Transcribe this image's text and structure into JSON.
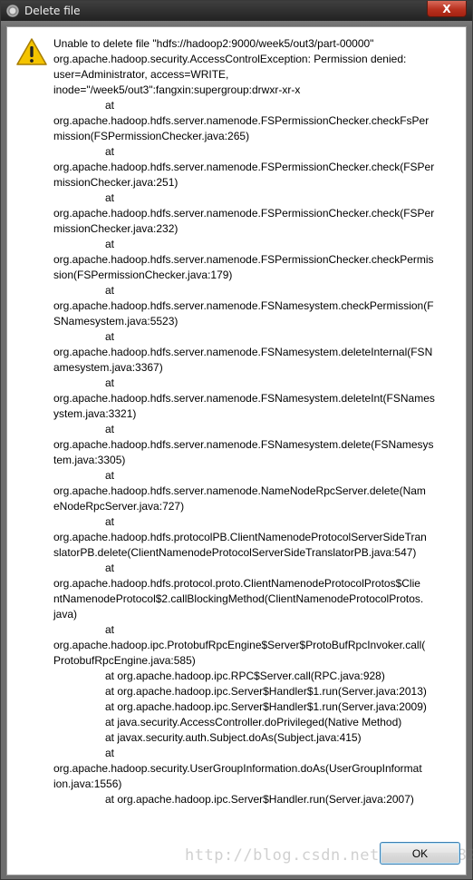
{
  "window": {
    "title": "Delete file",
    "close_label": "X"
  },
  "dialog": {
    "icon": "warning-icon",
    "message_lines": [
      {
        "text": "Unable to delete file \"hdfs://hadoop2:9000/week5/out3/part-00000\"",
        "indent": false
      },
      {
        "text": "org.apache.hadoop.security.AccessControlException: Permission denied:",
        "indent": false
      },
      {
        "text": "user=Administrator, access=WRITE,",
        "indent": false
      },
      {
        "text": "inode=\"/week5/out3\":fangxin:supergroup:drwxr-xr-x",
        "indent": false
      },
      {
        "text": "at",
        "indent": true
      },
      {
        "text": "org.apache.hadoop.hdfs.server.namenode.FSPermissionChecker.checkFsPer",
        "indent": false
      },
      {
        "text": "mission(FSPermissionChecker.java:265)",
        "indent": false
      },
      {
        "text": "at",
        "indent": true
      },
      {
        "text": "org.apache.hadoop.hdfs.server.namenode.FSPermissionChecker.check(FSPer",
        "indent": false
      },
      {
        "text": "missionChecker.java:251)",
        "indent": false
      },
      {
        "text": "at",
        "indent": true
      },
      {
        "text": "org.apache.hadoop.hdfs.server.namenode.FSPermissionChecker.check(FSPer",
        "indent": false
      },
      {
        "text": "missionChecker.java:232)",
        "indent": false
      },
      {
        "text": "at",
        "indent": true
      },
      {
        "text": "org.apache.hadoop.hdfs.server.namenode.FSPermissionChecker.checkPermis",
        "indent": false
      },
      {
        "text": "sion(FSPermissionChecker.java:179)",
        "indent": false
      },
      {
        "text": "at",
        "indent": true
      },
      {
        "text": "org.apache.hadoop.hdfs.server.namenode.FSNamesystem.checkPermission(F",
        "indent": false
      },
      {
        "text": "SNamesystem.java:5523)",
        "indent": false
      },
      {
        "text": "at",
        "indent": true
      },
      {
        "text": "org.apache.hadoop.hdfs.server.namenode.FSNamesystem.deleteInternal(FSN",
        "indent": false
      },
      {
        "text": "amesystem.java:3367)",
        "indent": false
      },
      {
        "text": "at",
        "indent": true
      },
      {
        "text": "org.apache.hadoop.hdfs.server.namenode.FSNamesystem.deleteInt(FSNames",
        "indent": false
      },
      {
        "text": "ystem.java:3321)",
        "indent": false
      },
      {
        "text": "at",
        "indent": true
      },
      {
        "text": "org.apache.hadoop.hdfs.server.namenode.FSNamesystem.delete(FSNamesys",
        "indent": false
      },
      {
        "text": "tem.java:3305)",
        "indent": false
      },
      {
        "text": "at",
        "indent": true
      },
      {
        "text": "org.apache.hadoop.hdfs.server.namenode.NameNodeRpcServer.delete(Nam",
        "indent": false
      },
      {
        "text": "eNodeRpcServer.java:727)",
        "indent": false
      },
      {
        "text": "at",
        "indent": true
      },
      {
        "text": "org.apache.hadoop.hdfs.protocolPB.ClientNamenodeProtocolServerSideTran",
        "indent": false
      },
      {
        "text": "slatorPB.delete(ClientNamenodeProtocolServerSideTranslatorPB.java:547)",
        "indent": false
      },
      {
        "text": "at",
        "indent": true
      },
      {
        "text": "org.apache.hadoop.hdfs.protocol.proto.ClientNamenodeProtocolProtos$Clie",
        "indent": false
      },
      {
        "text": "ntNamenodeProtocol$2.callBlockingMethod(ClientNamenodeProtocolProtos.",
        "indent": false
      },
      {
        "text": "java)",
        "indent": false
      },
      {
        "text": "at",
        "indent": true
      },
      {
        "text": "org.apache.hadoop.ipc.ProtobufRpcEngine$Server$ProtoBufRpcInvoker.call(",
        "indent": false
      },
      {
        "text": "ProtobufRpcEngine.java:585)",
        "indent": false
      },
      {
        "text": "at org.apache.hadoop.ipc.RPC$Server.call(RPC.java:928)",
        "indent": true
      },
      {
        "text": "at org.apache.hadoop.ipc.Server$Handler$1.run(Server.java:2013)",
        "indent": true
      },
      {
        "text": "at org.apache.hadoop.ipc.Server$Handler$1.run(Server.java:2009)",
        "indent": true
      },
      {
        "text": "at java.security.AccessController.doPrivileged(Native Method)",
        "indent": true
      },
      {
        "text": "at javax.security.auth.Subject.doAs(Subject.java:415)",
        "indent": true
      },
      {
        "text": "at",
        "indent": true
      },
      {
        "text": "org.apache.hadoop.security.UserGroupInformation.doAs(UserGroupInformat",
        "indent": false
      },
      {
        "text": "ion.java:1556)",
        "indent": false
      },
      {
        "text": "at org.apache.hadoop.ipc.Server$Handler.run(Server.java:2007)",
        "indent": true
      }
    ],
    "ok_label": "OK"
  },
  "watermark": "http://blog.csdn.net/u011116821",
  "colors": {
    "titlebar": "#2a2a2a",
    "close_button": "#c4402c",
    "warning": "#f2c200",
    "ok_border": "#3c7fb1"
  }
}
